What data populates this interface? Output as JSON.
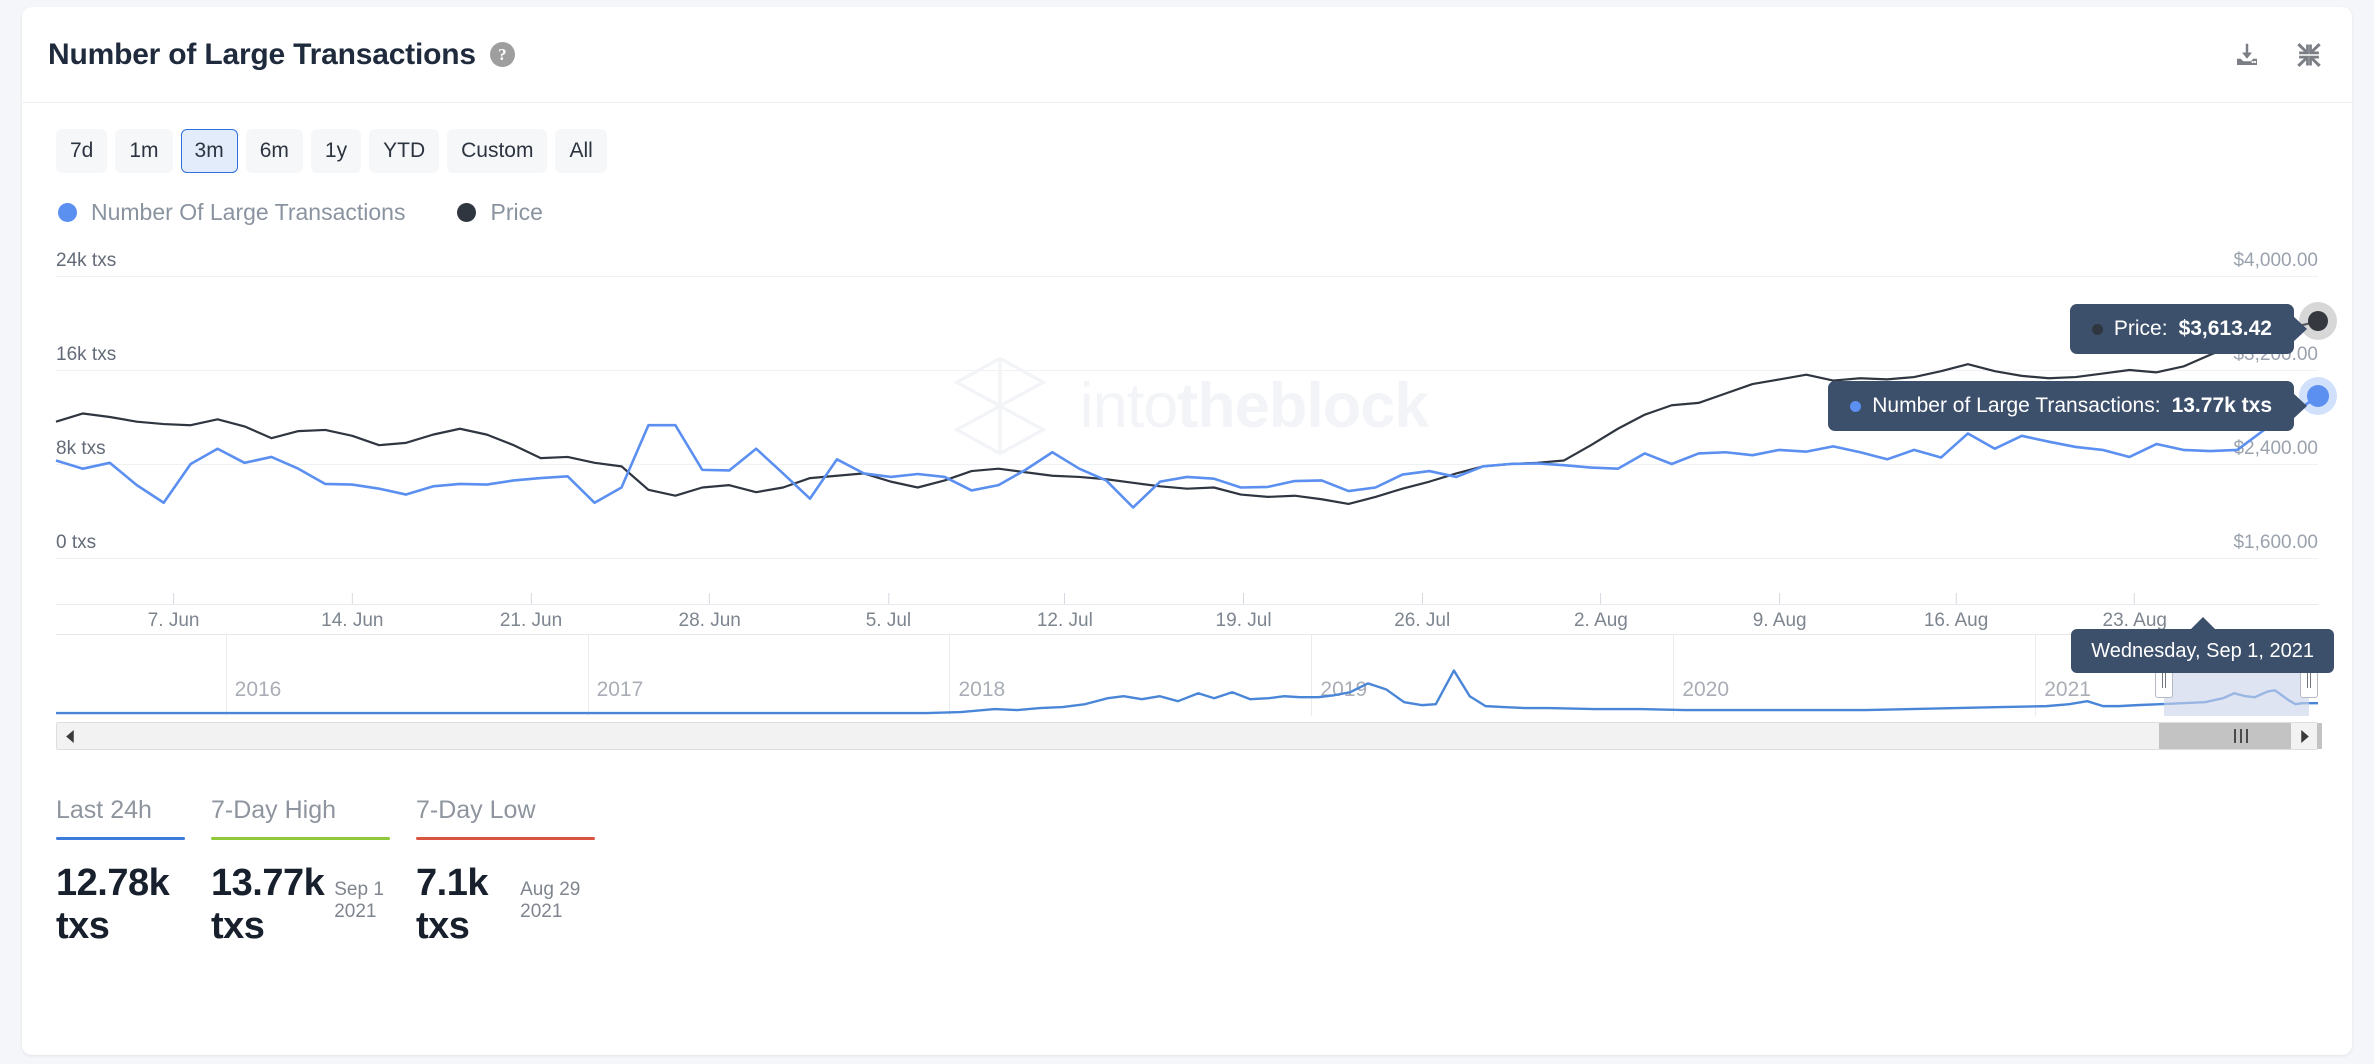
{
  "header": {
    "title": "Number of Large Transactions",
    "help_icon": "question-mark-icon",
    "download_icon": "download-icon",
    "collapse_icon": "collapse-icon"
  },
  "ranges": [
    {
      "label": "7d",
      "active": false
    },
    {
      "label": "1m",
      "active": false
    },
    {
      "label": "3m",
      "active": true
    },
    {
      "label": "6m",
      "active": false
    },
    {
      "label": "1y",
      "active": false
    },
    {
      "label": "YTD",
      "active": false
    },
    {
      "label": "Custom",
      "active": false
    },
    {
      "label": "All",
      "active": false
    }
  ],
  "legend": [
    {
      "label": "Number Of Large Transactions",
      "color": "#5b8ff0"
    },
    {
      "label": "Price",
      "color": "#2f3640"
    }
  ],
  "watermark": {
    "text_light": "into",
    "text_bold": "theblock"
  },
  "tooltips": {
    "price": {
      "label": "Price:",
      "value": "$3,613.42",
      "dot_color": "#2f3640"
    },
    "transactions": {
      "label": "Number of Large Transactions:",
      "value": "13.77k txs",
      "dot_color": "#5b8ff0"
    },
    "date": "Wednesday, Sep 1, 2021"
  },
  "navigator": {
    "years": [
      "2016",
      "2017",
      "2018",
      "2019",
      "2020",
      "2021"
    ],
    "selection_start_pct": 93.2,
    "selection_end_pct": 99.6
  },
  "scrollbar": {
    "left_arrow": "triangle-left-icon",
    "right_arrow": "triangle-right-icon"
  },
  "stats": [
    {
      "label": "Last 24h",
      "value": "12.78k txs",
      "date": "",
      "color": "#3a7bdc"
    },
    {
      "label": "7-Day High",
      "value": "13.77k txs",
      "date": "Sep 1 2021",
      "color": "#8fc93a"
    },
    {
      "label": "7-Day Low",
      "value": "7.1k txs",
      "date": "Aug 29 2021",
      "color": "#d9543f"
    }
  ],
  "chart_data": {
    "type": "line",
    "title": "Number of Large Transactions",
    "xlabel": "",
    "ylabel": "Number of Large Transactions",
    "y2label": "Price",
    "grid": true,
    "legend_position": "top-left",
    "y_ticks": [
      "0 txs",
      "8k txs",
      "16k txs",
      "24k txs"
    ],
    "ylim": [
      0,
      24000
    ],
    "y2_ticks": [
      "$1,600.00",
      "$2,400.00",
      "$3,200.00",
      "$4,000.00"
    ],
    "y2lim": [
      1600,
      4000
    ],
    "x_ticks": [
      "7. Jun",
      "14. Jun",
      "21. Jun",
      "28. Jun",
      "5. Jul",
      "12. Jul",
      "19. Jul",
      "26. Jul",
      "2. Aug",
      "9. Aug",
      "16. Aug",
      "23. Aug"
    ],
    "x_tick_positions_pct": [
      5.2,
      13.1,
      21.0,
      28.9,
      36.8,
      44.6,
      52.5,
      60.4,
      68.3,
      76.2,
      84.0,
      91.9
    ],
    "series": [
      {
        "name": "Number Of Large Transactions",
        "color": "#5b8ff0",
        "axis": "left",
        "unit": "txs",
        "values": [
          8300,
          7600,
          8100,
          6200,
          4700,
          8000,
          9300,
          8100,
          8600,
          7600,
          6300,
          6250,
          5900,
          5400,
          6100,
          6300,
          6250,
          6600,
          6800,
          6950,
          4700,
          6000,
          11300,
          11300,
          7500,
          7450,
          9300,
          7200,
          5050,
          8400,
          7200,
          6900,
          7150,
          6900,
          5750,
          6200,
          7500,
          9000,
          7600,
          6600,
          4300,
          6500,
          6900,
          6750,
          6000,
          6050,
          6550,
          6600,
          5700,
          6000,
          7100,
          7400,
          6900,
          7800,
          8000,
          8050,
          7900,
          7700,
          7600,
          8900,
          8000,
          8900,
          9000,
          8750,
          9200,
          9050,
          9500,
          9000,
          8400,
          9200,
          8550,
          10600,
          9300,
          10400,
          9900,
          9450,
          9200,
          8600,
          9700,
          9200,
          9100,
          9200,
          10900,
          12200,
          13770
        ],
        "last_value": 13770
      },
      {
        "name": "Price",
        "color": "#2f3640",
        "axis": "right",
        "unit": "$",
        "values": [
          2760,
          2830,
          2800,
          2760,
          2740,
          2730,
          2780,
          2720,
          2620,
          2680,
          2690,
          2640,
          2560,
          2580,
          2650,
          2700,
          2650,
          2560,
          2450,
          2460,
          2410,
          2380,
          2180,
          2130,
          2200,
          2220,
          2160,
          2200,
          2280,
          2300,
          2320,
          2250,
          2200,
          2260,
          2340,
          2360,
          2330,
          2300,
          2290,
          2270,
          2240,
          2210,
          2190,
          2200,
          2140,
          2120,
          2130,
          2100,
          2060,
          2120,
          2190,
          2250,
          2320,
          2380,
          2400,
          2410,
          2430,
          2560,
          2700,
          2820,
          2900,
          2920,
          3000,
          3080,
          3120,
          3160,
          3110,
          3130,
          3120,
          3140,
          3190,
          3250,
          3190,
          3150,
          3130,
          3140,
          3170,
          3200,
          3180,
          3230,
          3330,
          3420,
          3500,
          3560,
          3613.42
        ],
        "last_value": 3613.42
      }
    ],
    "navigator_series": {
      "name": "Number Of Large Transactions",
      "color": "#5b8ff0",
      "description": "overview 2015-2021, flat until 2017 then rising with spikes in late 2017/early 2018 and a rise in 2021"
    }
  }
}
